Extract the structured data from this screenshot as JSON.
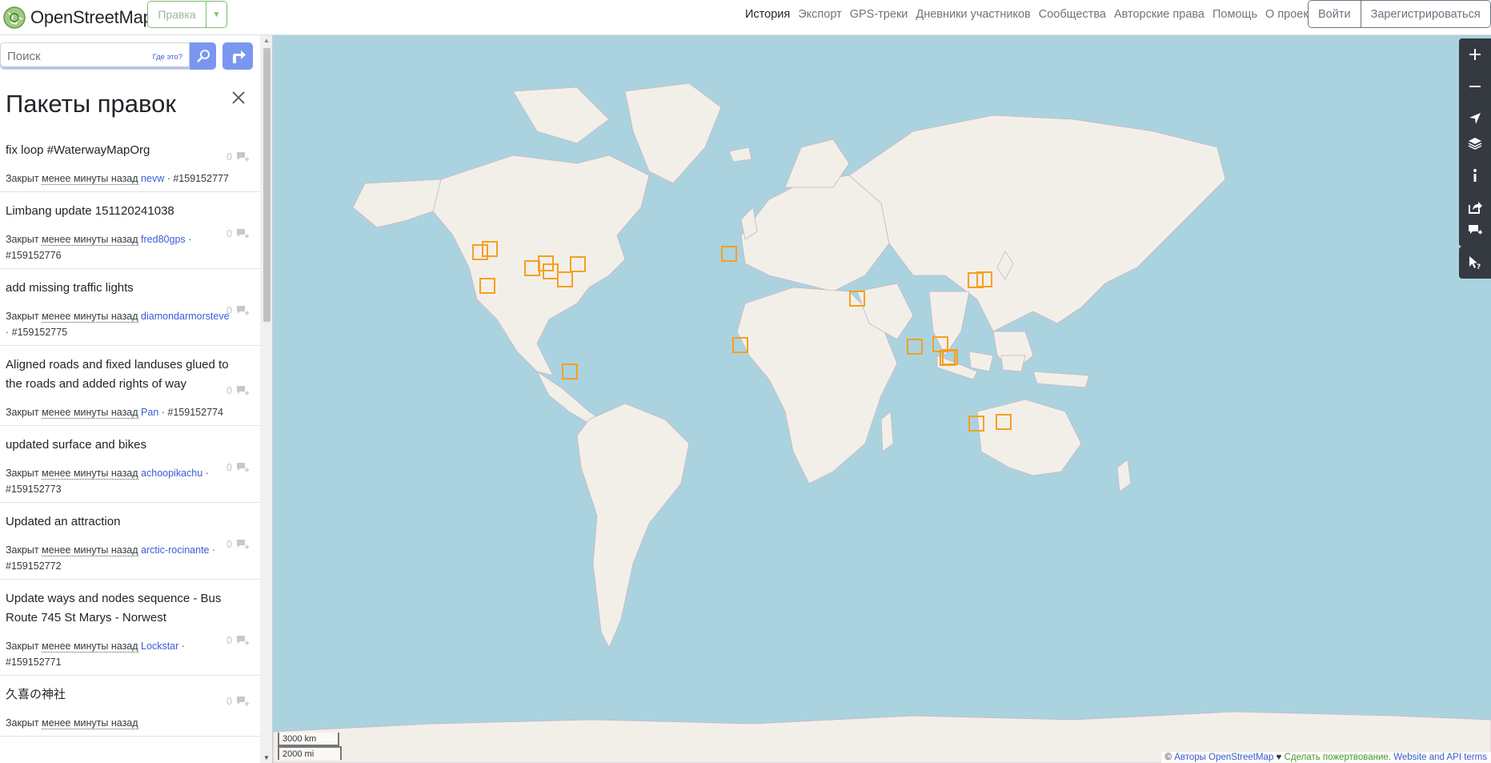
{
  "header": {
    "logo_text": "OpenStreetMap",
    "edit_label": "Правка",
    "nav": [
      "История",
      "Экспорт",
      "GPS-треки",
      "Дневники участников",
      "Сообщества",
      "Авторские права",
      "Помощь",
      "О проекте"
    ],
    "active_nav": "История",
    "login_label": "Войти",
    "signup_label": "Зарегистрироваться"
  },
  "search": {
    "placeholder": "Поиск",
    "where_label": "Где это?"
  },
  "panel": {
    "title": "Пакеты правок",
    "closed_label": "Закрыт",
    "when_label": "менее минуты назад"
  },
  "changesets": [
    {
      "title": "fix loop #WaterwayMapOrg",
      "user": "nevw",
      "id": "#159152777",
      "comments": "0"
    },
    {
      "title": "Limbang update 151120241038",
      "user": "fred80gps",
      "id": "#159152776",
      "comments": "0"
    },
    {
      "title": "add missing traffic lights",
      "user": "diamondarmorsteve",
      "id": "#159152775",
      "comments": "0"
    },
    {
      "title": "Aligned roads and fixed landuses glued to the roads and added rights of way",
      "user": "Pan",
      "id": "#159152774",
      "comments": "0"
    },
    {
      "title": "updated surface and bikes",
      "user": "achoopikachu",
      "id": "#159152773",
      "comments": "0"
    },
    {
      "title": "Updated an attraction",
      "user": "arctic-rocinante",
      "id": "#159152772",
      "comments": "0"
    },
    {
      "title": "Update ways and nodes sequence - Bus Route 745 St Marys - Norwest",
      "user": "Lockstar",
      "id": "#159152771",
      "comments": "0"
    },
    {
      "title": "久喜の神社",
      "user": "",
      "id": "",
      "comments": "0"
    }
  ],
  "map": {
    "scale_km": "3000 km",
    "scale_mi": "2000 mi",
    "attribution": {
      "copyright": "©",
      "authors_prefix": "Авторы",
      "authors_link": "OpenStreetMap",
      "heart": "♥",
      "donate": "Сделать пожертвование.",
      "terms": "Website and API terms"
    },
    "controls": [
      "zoom-in-icon",
      "zoom-out-icon",
      "locate-icon",
      "layers-icon",
      "info-icon",
      "share-icon",
      "add-note-icon",
      "query-icon"
    ],
    "colors": {
      "water": "#aad3df",
      "land": "#f2efe9",
      "changeset_box": "#f5a020"
    }
  }
}
